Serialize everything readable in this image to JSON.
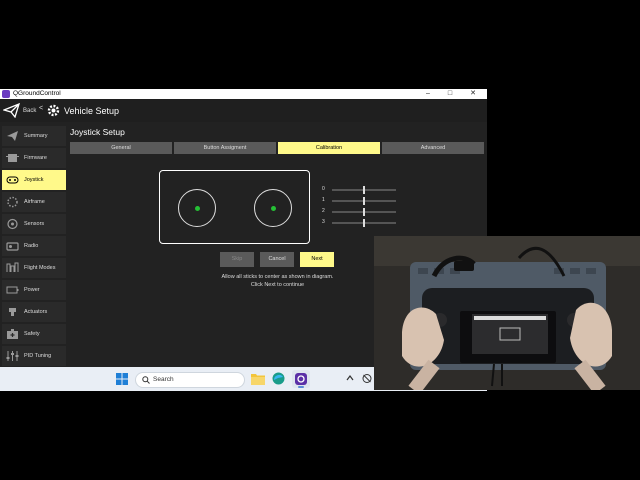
{
  "window": {
    "title": "QGroundControl",
    "controls": {
      "minimize": "–",
      "maximize": "□",
      "close": "✕"
    }
  },
  "toolbar": {
    "back_label": "Back",
    "separator": "<",
    "title": "Vehicle Setup"
  },
  "sidebar": {
    "items": [
      {
        "label": "Summary",
        "icon": "paper-plane-icon",
        "active": false
      },
      {
        "label": "Firmware",
        "icon": "firmware-icon",
        "active": false
      },
      {
        "label": "Joystick",
        "icon": "gamepad-icon",
        "active": true
      },
      {
        "label": "Airframe",
        "icon": "airframe-icon",
        "active": false
      },
      {
        "label": "Sensors",
        "icon": "sensors-icon",
        "active": false
      },
      {
        "label": "Radio",
        "icon": "radio-icon",
        "active": false
      },
      {
        "label": "Flight Modes",
        "icon": "flight-modes-icon",
        "active": false
      },
      {
        "label": "Power",
        "icon": "battery-icon",
        "active": false
      },
      {
        "label": "Actuators",
        "icon": "actuators-icon",
        "active": false
      },
      {
        "label": "Safety",
        "icon": "safety-icon",
        "active": false
      },
      {
        "label": "PID Tuning",
        "icon": "sliders-icon",
        "active": false
      }
    ]
  },
  "page": {
    "heading": "Joystick Setup",
    "tabs": [
      {
        "label": "General",
        "active": false
      },
      {
        "label": "Button Assigment",
        "active": false
      },
      {
        "label": "Calibration",
        "active": true
      },
      {
        "label": "Advanced",
        "active": false
      }
    ],
    "axes": [
      {
        "label": "0",
        "value": 0.0
      },
      {
        "label": "1",
        "value": 0.0
      },
      {
        "label": "2",
        "value": 0.0
      },
      {
        "label": "3",
        "value": 0.0
      }
    ],
    "buttons": {
      "skip": "Skip",
      "cancel": "Cancel",
      "next": "Next"
    },
    "instructions": {
      "line1": "Allow all sticks to center as shown in diagram.",
      "line2": "Click Next to continue"
    }
  },
  "taskbar": {
    "search_placeholder": "Search",
    "icons": [
      "windows-start-icon",
      "search-icon",
      "file-explorer-icon",
      "edge-browser-icon",
      "qgroundcontrol-app-icon"
    ],
    "tray": [
      "chevron-up-icon",
      "network-icon"
    ]
  },
  "colors": {
    "accent": "#fff98a",
    "stick_dot": "#25c035",
    "panel_bg": "#222222",
    "taskbar_bg": "#e9eef5"
  }
}
